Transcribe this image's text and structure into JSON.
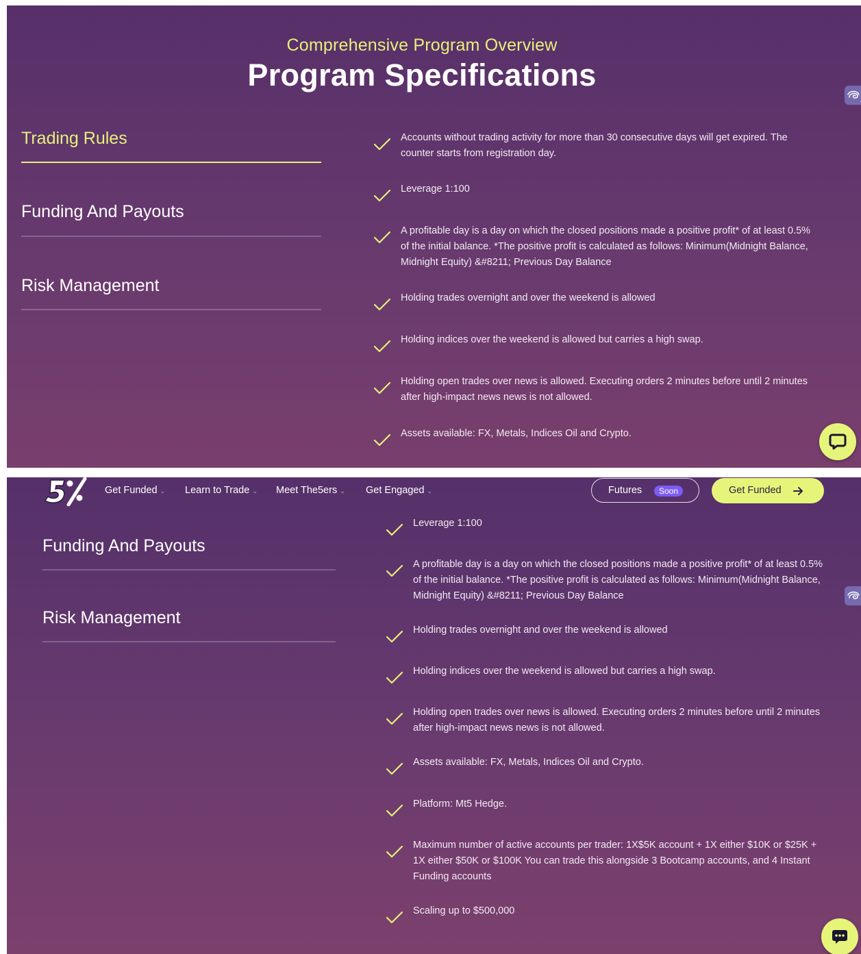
{
  "colors": {
    "accent": "#e6f07a",
    "background_top": "#572f69",
    "background_bottom": "#7c406d",
    "badge": "#7c5cf2"
  },
  "section": {
    "eyebrow": "Comprehensive Program Overview",
    "title": "Program Specifications"
  },
  "tabs": [
    {
      "label": "Trading Rules",
      "active": true
    },
    {
      "label": "Funding And Payouts",
      "active": false
    },
    {
      "label": "Risk Management",
      "active": false
    }
  ],
  "rules": [
    "Accounts without trading activity for more than 30 consecutive days will get expired. The counter starts from registration day.",
    "Leverage 1:100",
    "A profitable day is a day on which the closed positions made a positive profit* of at least 0.5% of the initial balance. *The positive profit is calculated as follows: Minimum(Midnight Balance, Midnight Equity) &#8211; Previous Day Balance",
    "Holding trades overnight and over the weekend is allowed",
    "Holding indices over the weekend is allowed but carries a high swap.",
    "Holding open trades over news is allowed. Executing orders 2 minutes before until 2 minutes after high-impact news news is not allowed.",
    "Assets available: FX, Metals, Indices Oil and Crypto.",
    "Platform: Mt5 Hedge.",
    "Maximum number of active accounts per trader: 1X$5K account + 1X either $10K or $25K + 1X either $50K or $100K You can trade this alongside 3 Bootcamp accounts, and 4 Instant Funding accounts",
    "Scaling up to $500,000"
  ],
  "nav": {
    "logo_text": "5%",
    "items": [
      "Get Funded",
      "Learn to Trade",
      "Meet The5ers",
      "Get Engaged"
    ],
    "futures_label": "Futures",
    "soon_badge": "Soon",
    "cta_label": "Get Funded"
  },
  "icons": {
    "check": "check-icon",
    "side_tab": "accessibility-icon",
    "chat": "chat-bubble-icon",
    "nav_chevron": "chevron-down-icon",
    "cta_arrow": "arrow-right-icon"
  }
}
